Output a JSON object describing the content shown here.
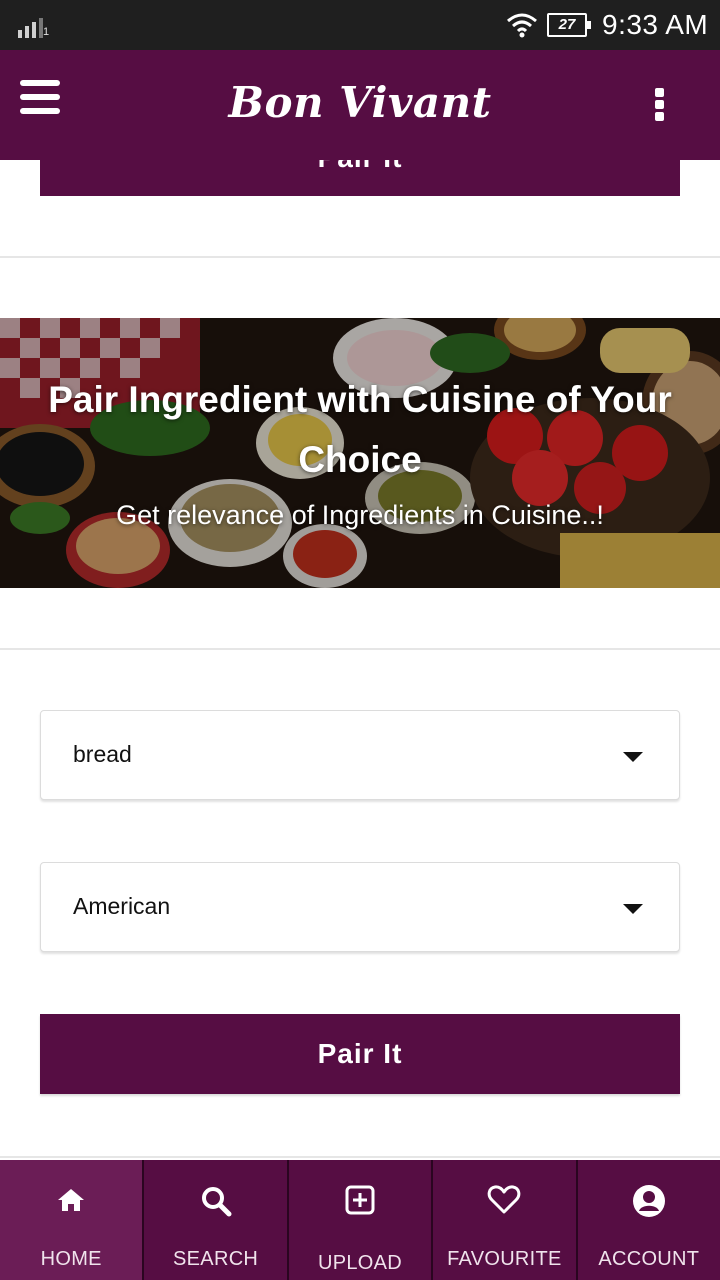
{
  "status_bar": {
    "signal_sub": "1",
    "battery": "27",
    "time": "9:33 AM"
  },
  "app_bar": {
    "title": "Bon Vivant",
    "icons": [
      "menu-icon",
      "more-vert-icon"
    ]
  },
  "top_button": {
    "label": "Pair It"
  },
  "hero": {
    "title": "Pair Ingredient with Cuisine of Your Choice",
    "subtitle": "Get relevance of Ingredients in Cuisine..!"
  },
  "form": {
    "ingredient_select": {
      "value": "bread"
    },
    "cuisine_select": {
      "value": "American"
    },
    "submit_label": "Pair It"
  },
  "bottom_nav": {
    "items": [
      {
        "label": "HOME",
        "icon": "home-icon",
        "active": true
      },
      {
        "label": "SEARCH",
        "icon": "search-icon"
      },
      {
        "label": "UPLOAD",
        "icon": "upload-icon"
      },
      {
        "label": "FAVOURITE",
        "icon": "heart-icon"
      },
      {
        "label": "ACCOUNT",
        "icon": "account-icon"
      }
    ]
  },
  "colors": {
    "primary": "#560d43",
    "active_tab": "#6b1d56",
    "status_bar": "#1f1f1f"
  }
}
